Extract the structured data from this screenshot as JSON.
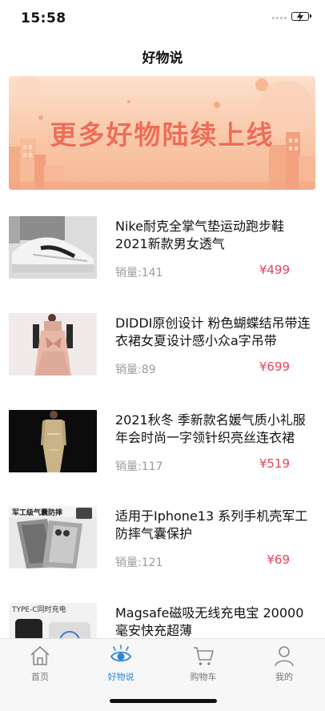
{
  "status_bar": {
    "time": "15:58"
  },
  "nav": {
    "title": "好物说"
  },
  "banner": {
    "text": "更多好物陆续上线"
  },
  "products": [
    {
      "title": "Nike耐克全掌气垫运动跑步鞋2021新款男女透气",
      "sales": "销量:141",
      "price": "¥499",
      "image": "sneaker-image"
    },
    {
      "title": "DIDDI原创设计 粉色蝴蝶结吊带连衣裙女夏设计感小众a字吊带",
      "sales": "销量:89",
      "price": "¥699",
      "image": "pink-dress-image"
    },
    {
      "title": "2021秋冬 季新款名媛气质小礼服年会时尚一字领针织亮丝连衣裙",
      "sales": "销量:117",
      "price": "¥519",
      "image": "gold-dress-image"
    },
    {
      "title": "适用于Iphone13 系列手机壳军工防摔气囊保护",
      "sales": "销量:121",
      "price": "¥69",
      "image": "phone-case-image",
      "thumb_text": "军工级气囊防摔"
    },
    {
      "title": "Magsafe磁吸无线充电宝 20000毫安快充超薄",
      "sales": "",
      "price": "",
      "image": "power-bank-image",
      "thumb_text": "TYPE-C同时充电"
    }
  ],
  "tab_bar": {
    "tabs": [
      {
        "label": "首页",
        "icon": "home-icon",
        "active": false
      },
      {
        "label": "好物说",
        "icon": "eye-icon",
        "active": true
      },
      {
        "label": "购物车",
        "icon": "cart-icon",
        "active": false
      },
      {
        "label": "我的",
        "icon": "user-icon",
        "active": false
      }
    ]
  },
  "colors": {
    "price": "#e8435a",
    "active_tab": "#2f86d6",
    "banner_text": "#ef6d55"
  }
}
